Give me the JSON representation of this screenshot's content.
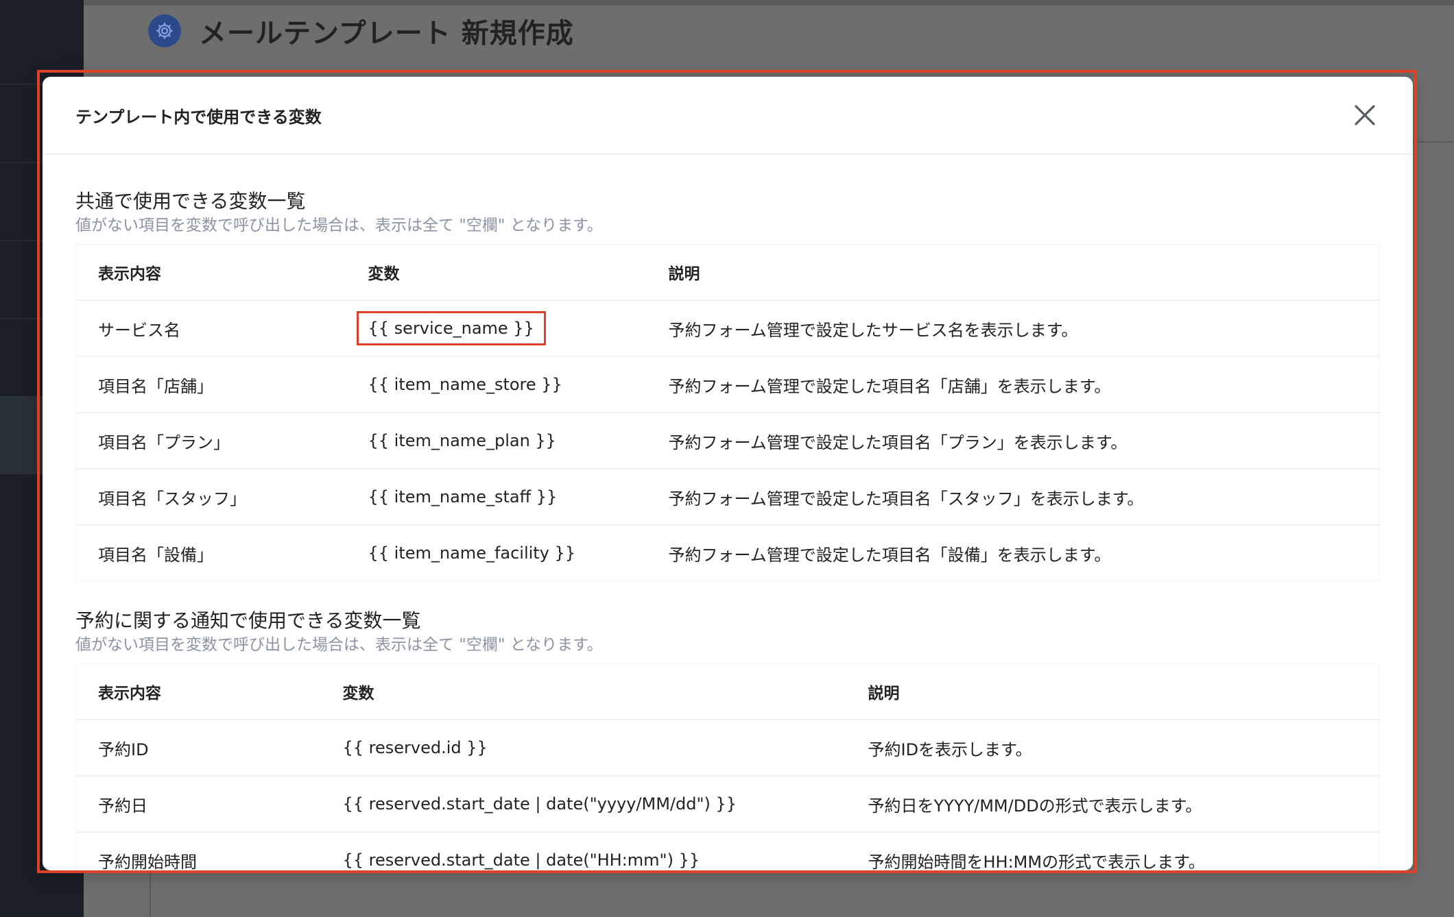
{
  "page": {
    "title": "メールテンプレート 新規作成"
  },
  "modal": {
    "title": "テンプレート内で使用できる変数",
    "sections": [
      {
        "title": "共通で使用できる変数一覧",
        "note": "値がない項目を変数で呼び出した場合は、表示は全て \"空欄\" となります。",
        "headers": [
          "表示内容",
          "変数",
          "説明"
        ],
        "rows": [
          {
            "label": "サービス名",
            "variable": "{{ service_name }}",
            "description": "予約フォーム管理で設定したサービス名を表示します。"
          },
          {
            "label": "項目名「店舗」",
            "variable": "{{ item_name_store }}",
            "description": "予約フォーム管理で設定した項目名「店舗」を表示します。"
          },
          {
            "label": "項目名「プラン」",
            "variable": "{{ item_name_plan }}",
            "description": "予約フォーム管理で設定した項目名「プラン」を表示します。"
          },
          {
            "label": "項目名「スタッフ」",
            "variable": "{{ item_name_staff }}",
            "description": "予約フォーム管理で設定した項目名「スタッフ」を表示します。"
          },
          {
            "label": "項目名「設備」",
            "variable": "{{ item_name_facility }}",
            "description": "予約フォーム管理で設定した項目名「設備」を表示します。"
          }
        ]
      },
      {
        "title": "予約に関する通知で使用できる変数一覧",
        "note": "値がない項目を変数で呼び出した場合は、表示は全て \"空欄\" となります。",
        "headers": [
          "表示内容",
          "変数",
          "説明"
        ],
        "rows": [
          {
            "label": "予約ID",
            "variable": "{{ reserved.id }}",
            "description": "予約IDを表示します。"
          },
          {
            "label": "予約日",
            "variable": "{{ reserved.start_date | date(\"yyyy/MM/dd\") }}",
            "description": "予約日をYYYY/MM/DDの形式で表示します。"
          },
          {
            "label": "予約開始時間",
            "variable": "{{ reserved.start_date | date(\"HH:mm\") }}",
            "description": "予約開始時間をHH:MMの形式で表示します。"
          }
        ]
      }
    ]
  },
  "icons": {
    "header_icon": "gear-icon",
    "close": "close-icon"
  },
  "colors": {
    "highlight": "#e0402a",
    "note_text": "#8b93a3",
    "header_badge": "#2c4a8a"
  }
}
